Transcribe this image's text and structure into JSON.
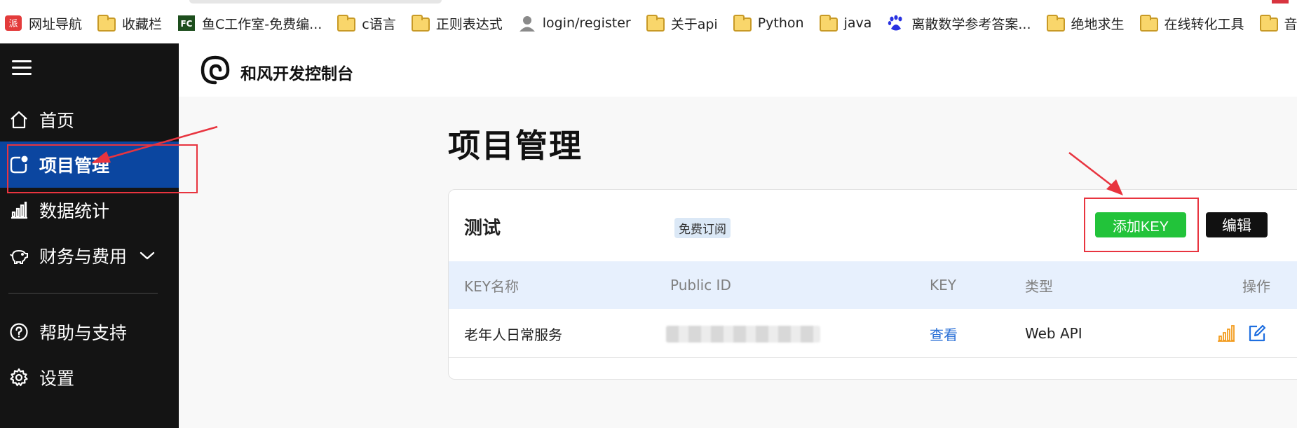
{
  "bookmarks": [
    {
      "label": "网址导航",
      "icon": "red-badge-icon"
    },
    {
      "label": "收藏栏",
      "icon": "folder-icon"
    },
    {
      "label": "鱼C工作室-免费编...",
      "icon": "fc-logo-icon"
    },
    {
      "label": "c语言",
      "icon": "folder-icon"
    },
    {
      "label": "正则表达式",
      "icon": "folder-icon"
    },
    {
      "label": "login/register",
      "icon": "user-icon"
    },
    {
      "label": "关于api",
      "icon": "folder-icon"
    },
    {
      "label": "Python",
      "icon": "folder-icon"
    },
    {
      "label": "java",
      "icon": "folder-icon"
    },
    {
      "label": "离散数学参考答案...",
      "icon": "baidu-paw-icon"
    },
    {
      "label": "绝地求生",
      "icon": "folder-icon"
    },
    {
      "label": "在线转化工具",
      "icon": "folder-icon"
    },
    {
      "label": "音乐解析",
      "icon": "folder-icon"
    }
  ],
  "bookmark_icon_text": {
    "badge": "派",
    "fc": "FC"
  },
  "sidebar": {
    "items": [
      {
        "label": "首页",
        "icon": "home-icon"
      },
      {
        "label": "项目管理",
        "icon": "project-icon",
        "active": true
      },
      {
        "label": "数据统计",
        "icon": "bar-chart-icon"
      },
      {
        "label": "财务与费用",
        "icon": "piggy-bank-icon"
      },
      {
        "label": "帮助与支持",
        "icon": "help-circle-icon"
      },
      {
        "label": "设置",
        "icon": "gear-icon"
      }
    ]
  },
  "header": {
    "brand": "和风开发控制台"
  },
  "main": {
    "title": "项目管理",
    "project": {
      "name": "测试",
      "badge": "免费订阅",
      "add_key_label": "添加KEY",
      "edit_label": "编辑",
      "columns": [
        "KEY名称",
        "Public ID",
        "KEY",
        "类型",
        "操作"
      ],
      "rows": [
        {
          "name": "老年人日常服务",
          "key_action": "查看",
          "type": "Web API"
        }
      ]
    }
  },
  "colors": {
    "sidebar_bg": "#141414",
    "active_item": "#0b46a0",
    "add_button": "#22c33a",
    "edit_button": "#111111",
    "table_header": "#e7f0fd",
    "link": "#2a6fd6",
    "annotation": "#e8343f",
    "stats_icon": "#f39c1f"
  }
}
